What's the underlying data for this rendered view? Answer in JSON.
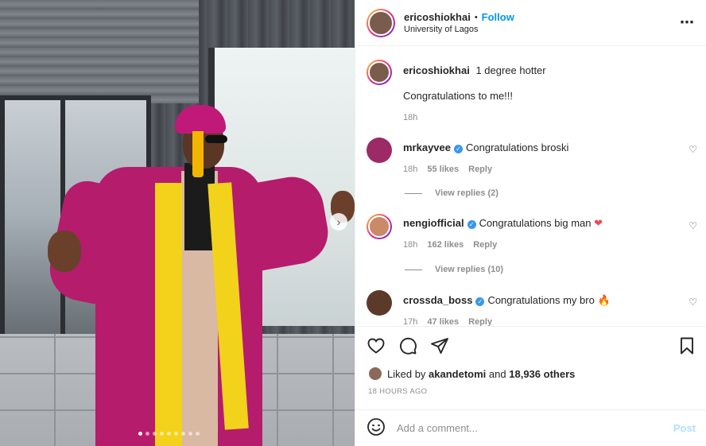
{
  "header": {
    "username": "ericoshiokhai",
    "separator": "•",
    "follow_label": "Follow",
    "location": "University of Lagos",
    "more_icon": "⋯"
  },
  "photo": {
    "carousel_dots": 9,
    "active_dot": 0,
    "next_icon": "›"
  },
  "caption": {
    "username": "ericoshiokhai",
    "line1": "1 degree hotter",
    "line2": "Congratulations to me!!!",
    "time": "18h"
  },
  "comments": [
    {
      "username": "mrkayvee",
      "verified": true,
      "text": "Congratulations broski",
      "emoji": "",
      "time": "18h",
      "likes": "55 likes",
      "reply": "Reply",
      "view_replies": "View replies (2)",
      "avatar_color": "#9b2a66"
    },
    {
      "username": "nengiofficial",
      "verified": true,
      "text": "Congratulations big man",
      "emoji": "❤",
      "time": "18h",
      "likes": "162 likes",
      "reply": "Reply",
      "view_replies": "View replies (10)",
      "avatar_color": "#c98a6a"
    },
    {
      "username": "crossda_boss",
      "verified": true,
      "text": "Congratulations my bro",
      "emoji": "🔥",
      "time": "17h",
      "likes": "47 likes",
      "reply": "Reply",
      "view_replies": "",
      "avatar_color": "#5c3a2a"
    }
  ],
  "actions": {
    "like_icon": "heart-icon",
    "comment_icon": "comment-icon",
    "share_icon": "share-icon",
    "save_icon": "bookmark-icon"
  },
  "likes": {
    "prefix": "Liked by",
    "user": "akandetomi",
    "and": "and",
    "others": "18,936 others"
  },
  "timestamp": "18 HOURS AGO",
  "add_comment": {
    "placeholder": "Add a comment...",
    "post_label": "Post"
  },
  "colors": {
    "accent": "#0095f6",
    "verified": "#3897f0",
    "muted": "#8e8e8e",
    "post_disabled": "#b2dffc"
  }
}
